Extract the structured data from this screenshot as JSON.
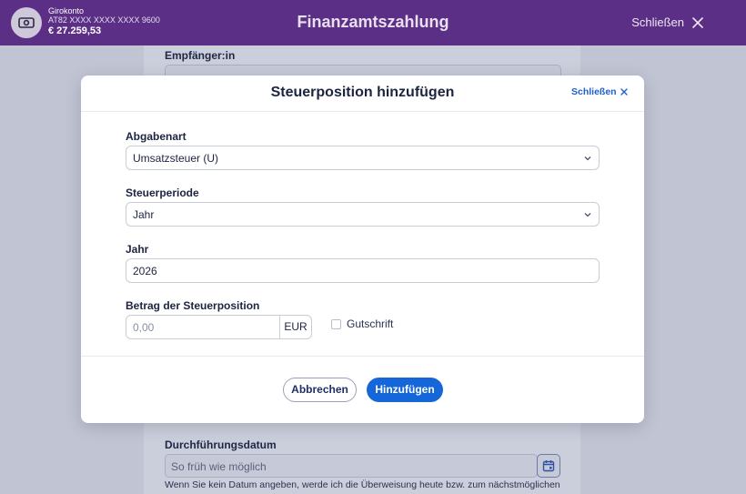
{
  "header": {
    "account_name": "Girokonto",
    "account_iban": "AT82 XXXX XXXX XXXX 9600",
    "account_balance": "€ 27.259,53",
    "title": "Finanzamtszahlung",
    "close_label": "Schließen"
  },
  "background_form": {
    "recipient_label": "Empfänger:in",
    "execution_date_label": "Durchführungsdatum",
    "execution_date_placeholder": "So früh wie möglich",
    "execution_date_note": "Wenn Sie kein Datum angeben, werde ich die Überweisung heute bzw. zum nächstmöglichen"
  },
  "modal": {
    "title": "Steuerposition hinzufügen",
    "close_label": "Schließen",
    "tax_type_label": "Abgabenart",
    "tax_type_value": "Umsatzsteuer (U)",
    "tax_period_label": "Steuerperiode",
    "tax_period_value": "Jahr",
    "year_label": "Jahr",
    "year_value": "2026",
    "amount_label": "Betrag der Steuerposition",
    "amount_placeholder": "0,00",
    "amount_unit": "EUR",
    "credit_label": "Gutschrift",
    "cancel_label": "Abbrechen",
    "add_label": "Hinzufügen"
  },
  "colors": {
    "header_bg": "#5c2f86",
    "primary": "#1566d8",
    "overlay": "#c1c5d3"
  }
}
